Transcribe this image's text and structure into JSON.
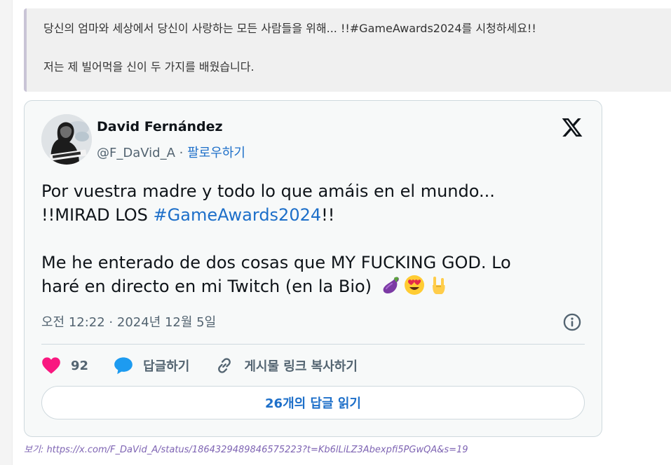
{
  "quote": {
    "line1": "당신의 엄마와 세상에서 당신이 사랑하는 모든 사람들을 위해... !!#GameAwards2024를 시청하세요!!",
    "line2": "저는 제 빌어먹을 신이 두 가지를 배웠습니다."
  },
  "tweet": {
    "author_name": "David Fernández",
    "handle": "@F_DaVid_A",
    "separator": " · ",
    "follow_label": "팔로우하기",
    "body": {
      "line1": "Por vuestra madre y todo lo que amáis en el mundo...",
      "line2_prefix": "!!MIRAD LOS ",
      "hashtag": "#GameAwards2024",
      "line2_suffix": "!!",
      "line3": "Me he enterado de dos cosas que MY FUCKING GOD. Lo",
      "line4": "haré en directo en mi Twitch (en la Bio)",
      "emojis": [
        "eggplant-emoji",
        "heart-eyes-emoji",
        "rock-hand-emoji"
      ]
    },
    "timestamp": "오전 12:22 · 2024년 12월 5일",
    "actions": {
      "like_count": "92",
      "reply_label": "답글하기",
      "copy_link_label": "게시물 링크 복사하기"
    },
    "read_replies_label": "26개의 답글 읽기",
    "colors": {
      "accent": "#1d6fc9",
      "like": "#f91880",
      "muted": "#536471"
    }
  },
  "source": {
    "prefix": "보기: ",
    "url": "https://x.com/F_DaVid_A/status/1864329489846575223?t=Kb6lLiLZ3Abexpfi5PGwQA&s=19"
  }
}
